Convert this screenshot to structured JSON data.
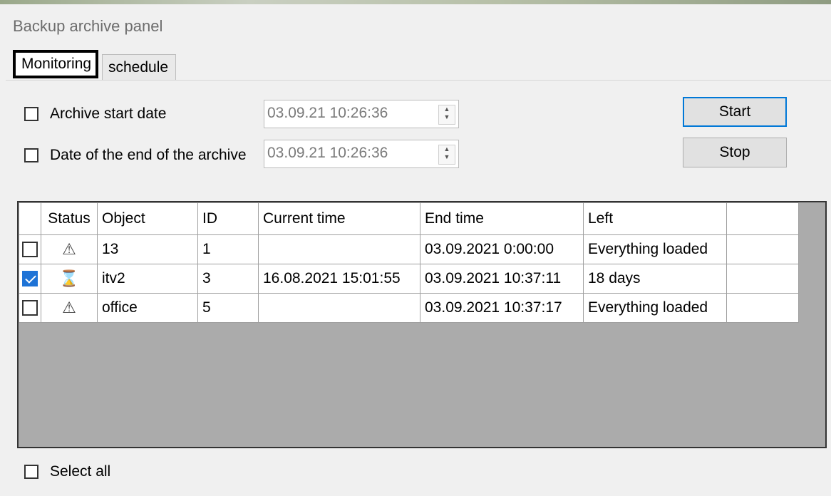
{
  "window": {
    "title": "Backup archive panel"
  },
  "tabs": [
    {
      "label": "Monitoring",
      "active": true
    },
    {
      "label": "schedule",
      "active": false
    }
  ],
  "filters": {
    "start": {
      "label": "Archive start date",
      "value": "03.09.21 10:26:36",
      "checked": false
    },
    "end": {
      "label": "Date of the end of the archive",
      "value": "03.09.21 10:26:36",
      "checked": false
    }
  },
  "buttons": {
    "start": "Start",
    "stop": "Stop"
  },
  "table": {
    "headers": [
      "Status",
      "Object",
      "ID",
      "Current time",
      "End time",
      "Left"
    ],
    "rows": [
      {
        "checked": false,
        "status_icon": "warning-icon",
        "object": "13",
        "id": "1",
        "current_time": "",
        "end_time": "03.09.2021 0:00:00",
        "left": "Everything loaded"
      },
      {
        "checked": true,
        "status_icon": "hourglass-icon",
        "object": "itv2",
        "id": "3",
        "current_time": "16.08.2021 15:01:55",
        "end_time": "03.09.2021 10:37:11",
        "left": "18 days"
      },
      {
        "checked": false,
        "status_icon": "warning-icon",
        "object": "office",
        "id": "5",
        "current_time": "",
        "end_time": "03.09.2021 10:37:17",
        "left": "Everything loaded"
      }
    ]
  },
  "select_all": {
    "label": "Select all",
    "checked": false
  },
  "colors": {
    "accent": "#0078d7",
    "checked_bg": "#1e73d6",
    "grid_bg": "#ababab"
  }
}
